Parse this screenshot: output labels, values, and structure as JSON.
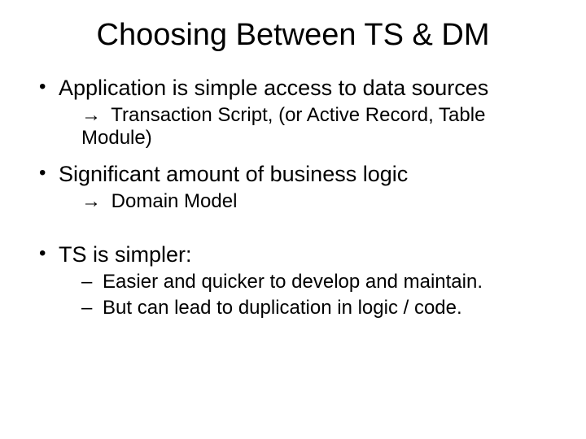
{
  "title": "Choosing Between TS & DM",
  "bullets": {
    "b1": "Application is simple access to data sources",
    "b1s1": "Transaction Script, (or Active Record, Table Module)",
    "b2": "Significant amount of business logic",
    "b2s1": "Domain Model",
    "b3": "TS is simpler:",
    "b3s1": "Easier and quicker to develop and maintain.",
    "b3s2": "But can lead to duplication in logic / code."
  }
}
